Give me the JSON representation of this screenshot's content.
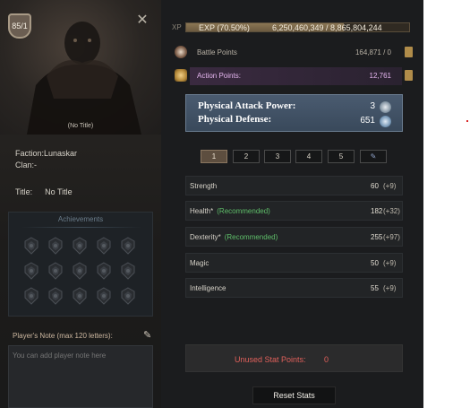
{
  "character": {
    "level_badge": "85/1",
    "title_small": "(No Title)",
    "faction_label": "Faction:",
    "faction_value": "Lunaskar",
    "clan_label": "Clan:",
    "clan_value": "-",
    "title_label": "Title:",
    "title_value": "No Title"
  },
  "achievements": {
    "header": "Achievements",
    "icon_count": 15
  },
  "note": {
    "label": "Player's Note (max 120 letters):",
    "placeholder": "You can add player note here"
  },
  "xp": {
    "label": "XP",
    "percent_text": "EXP (70.50%)",
    "fill_fraction": 0.705,
    "amount_text": "6,250,460,349 / 8,865,804,244"
  },
  "points": {
    "battle_label": "Battle Points",
    "battle_value": "164,871 / 0",
    "action_label": "Action Points:",
    "action_value": "12,761"
  },
  "combat": {
    "attack_label": "Physical Attack Power:",
    "attack_value": "3",
    "defense_label": "Physical Defense:",
    "defense_value": "651"
  },
  "tabs": [
    "1",
    "2",
    "3",
    "4",
    "5"
  ],
  "stats": [
    {
      "name": "Strength",
      "rec": "",
      "value": "60",
      "bonus": "(+9)"
    },
    {
      "name": "Health*",
      "rec": "(Recommended)",
      "value": "182",
      "bonus": "(+32)"
    },
    {
      "name": "Dexterity*",
      "rec": "(Recommended)",
      "value": "255",
      "bonus": "(+97)"
    },
    {
      "name": "Magic",
      "rec": "",
      "value": "50",
      "bonus": "(+9)"
    },
    {
      "name": "Intelligence",
      "rec": "",
      "value": "55",
      "bonus": "(+9)"
    }
  ],
  "unused": {
    "label": "Unused Stat Points:",
    "value": "0"
  },
  "reset_button": "Reset Stats",
  "colors": {
    "accent_red": "#e0605b",
    "recommended_green": "#5fbf6a",
    "action_purple": "#e6b7f0"
  }
}
